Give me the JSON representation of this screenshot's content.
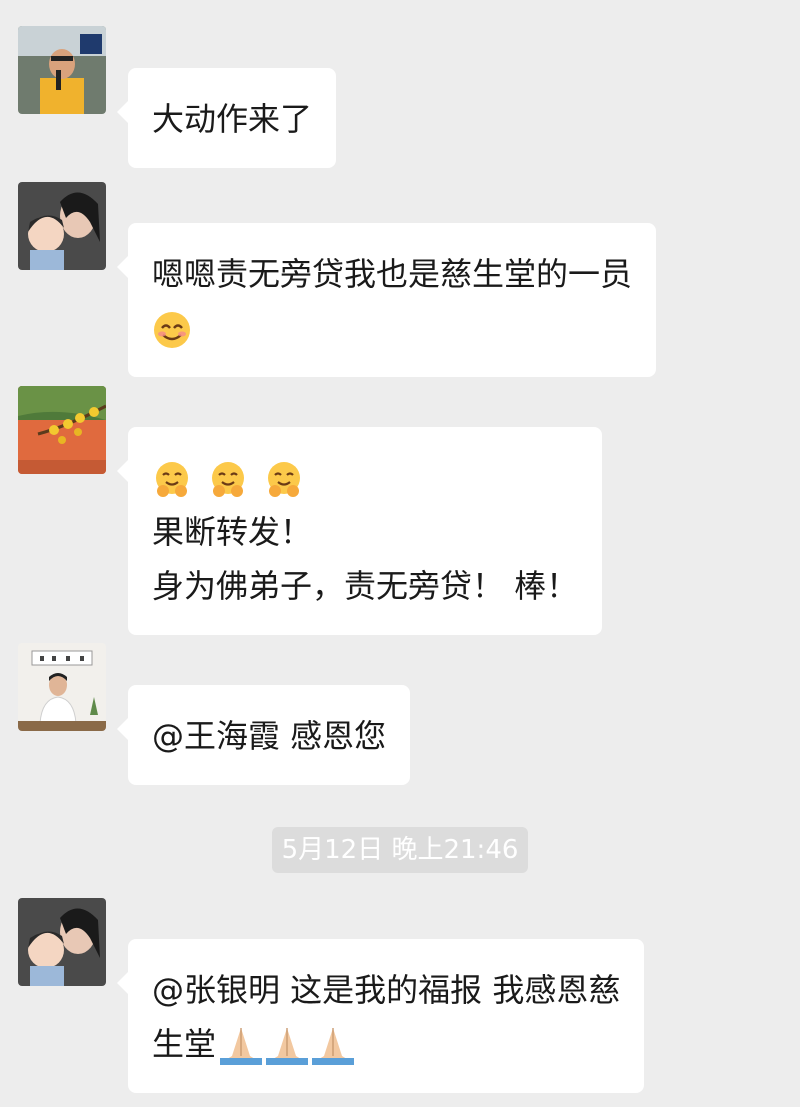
{
  "chat": {
    "messages": [
      {
        "lines": [
          "大动作来了"
        ],
        "avatar_icon": "speaker-avatar"
      },
      {
        "lines": [
          "嗯嗯责无旁贷我也是慈生堂的一员"
        ],
        "emoji_line": "smiling-face-emoji",
        "avatar_icon": "mother-child-avatar"
      },
      {
        "emoji_line": "hug-face-emoji x3",
        "lines": [
          "果断转发！",
          "身为佛弟子，责无旁贷！ 棒！"
        ],
        "avatar_icon": "ginkgo-leaves-avatar"
      },
      {
        "lines": [
          "@王海霞  感恩您"
        ],
        "avatar_icon": "office-man-avatar"
      },
      {
        "lines": [
          "@张银明  这是我的福报 我感恩慈",
          "生堂"
        ],
        "trailing_emoji": "folded-hands-emoji x3",
        "avatar_icon": "mother-child-avatar"
      }
    ],
    "timestamp": "5月12日 晚上21:46"
  }
}
